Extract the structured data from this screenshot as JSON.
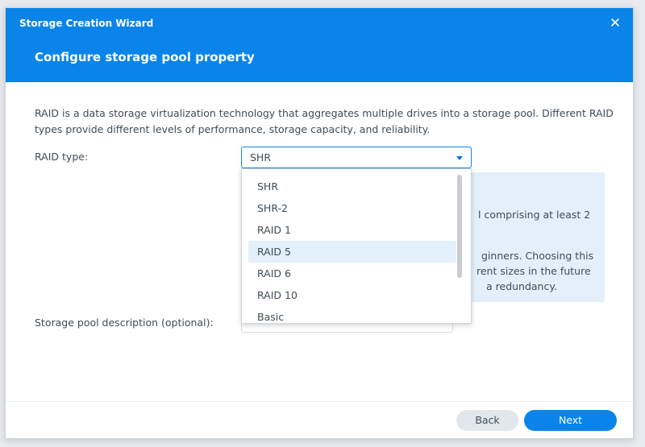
{
  "window": {
    "title": "Storage Creation Wizard",
    "close_icon": "close-icon"
  },
  "step": {
    "title": "Configure storage pool property"
  },
  "description": "RAID is a data storage virtualization technology that aggregates multiple drives into a storage pool. Different RAID types provide different levels of performance, storage capacity, and reliability.",
  "form": {
    "raid_type_label": "RAID type:",
    "raid_type_value": "SHR",
    "pool_description_label": "Storage pool description (optional):",
    "pool_description_value": ""
  },
  "info_box": {
    "lines": [
      "l comprising at least 2",
      "ginners. Choosing this",
      "rent sizes in the future",
      "a redundancy."
    ]
  },
  "dropdown": {
    "options": [
      "SHR",
      "SHR-2",
      "RAID 1",
      "RAID 5",
      "RAID 6",
      "RAID 10",
      "Basic"
    ],
    "hovered_option": "RAID 5"
  },
  "edge_glyph": "l",
  "buttons": {
    "back": "Back",
    "next": "Next"
  },
  "colors": {
    "header": "#0a84e8",
    "accent": "#0a84e8",
    "info_bg": "#e3f0fb",
    "hover_bg": "#e4f0fb"
  }
}
